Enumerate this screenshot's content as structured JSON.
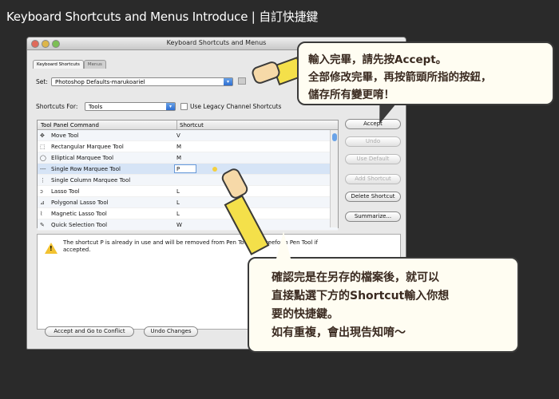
{
  "page_title": "Keyboard Shortcuts and Menus Introduce | 自訂快捷鍵",
  "window": {
    "title": "Keyboard Shortcuts and Menus",
    "tabs": [
      "Keyboard Shortcuts",
      "Menus"
    ],
    "set_label": "Set:",
    "set_value": "Photoshop Defaults-marukoariel",
    "shortcuts_for_label": "Shortcuts For:",
    "shortcuts_for_value": "Tools",
    "legacy_label": "Use Legacy Channel Shortcuts",
    "col_command": "Tool Panel Command",
    "col_shortcut": "Shortcut",
    "rows": [
      {
        "icon": "✥",
        "name": "Move Tool",
        "shortcut": "V"
      },
      {
        "icon": "⬚",
        "name": "Rectangular Marquee Tool",
        "shortcut": "M"
      },
      {
        "icon": "◯",
        "name": "Elliptical Marquee Tool",
        "shortcut": "M"
      },
      {
        "icon": "---",
        "name": "Single Row Marquee Tool",
        "shortcut": "P"
      },
      {
        "icon": "⋮",
        "name": "Single Column Marquee Tool",
        "shortcut": ""
      },
      {
        "icon": "ↄ",
        "name": "Lasso Tool",
        "shortcut": "L"
      },
      {
        "icon": "⊿",
        "name": "Polygonal Lasso Tool",
        "shortcut": "L"
      },
      {
        "icon": "⌇",
        "name": "Magnetic Lasso Tool",
        "shortcut": "L"
      },
      {
        "icon": "✎",
        "name": "Quick Selection Tool",
        "shortcut": "W"
      }
    ],
    "buttons": {
      "accept": "Accept",
      "undo": "Undo",
      "use_default": "Use Default",
      "add_shortcut": "Add Shortcut",
      "delete_shortcut": "Delete Shortcut",
      "summarize": "Summarize..."
    },
    "warning_text": "The shortcut P is already in use and will be removed from Pen Tool and Freeform Pen Tool if accepted.",
    "accept_conflict": "Accept and Go to Conflict",
    "undo_changes": "Undo Changes"
  },
  "bubble_top": [
    "輸入完畢，請先按Accept。",
    "全部修改完畢，再按箭頭所指的按鈕，",
    "儲存所有變更唷！"
  ],
  "bubble_bottom": [
    "確認完是在另存的檔案後，就可以",
    "直接點選下方的Shortcut輸入你想",
    "要的快捷鍵。",
    "如有重複，會出現告知唷～"
  ]
}
